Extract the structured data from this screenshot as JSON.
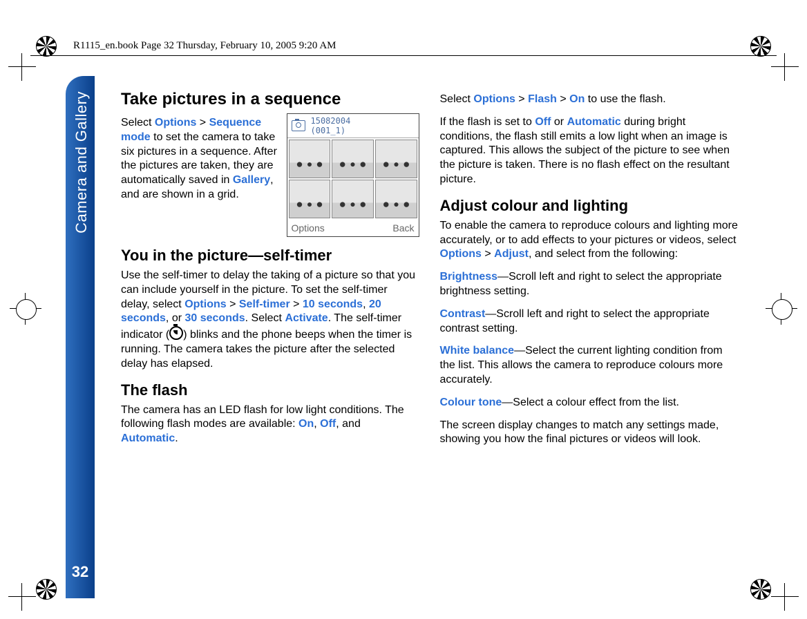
{
  "header": "R1115_en.book  Page 32  Thursday, February 10, 2005  9:20 AM",
  "sideTab": "Camera and Gallery",
  "pageNumber": "32",
  "left": {
    "h_seq": "Take pictures in a sequence",
    "seq_p1a": "Select ",
    "seq_options": "Options",
    "seq_gt1": " > ",
    "seq_mode": "Sequence mode",
    "seq_p1b": " to set the camera to take six pictures in a sequence. After the pictures are taken, they are automatically saved in ",
    "seq_gallery": "Gallery",
    "seq_p1c": ", and are shown in a grid.",
    "shot_date": "15082004",
    "shot_id": "(001_1)",
    "shot_opt": "Options",
    "shot_back": "Back",
    "h_timer": "You in the picture—self-timer",
    "timer_p1a": "Use the self-timer to delay the taking of a picture so that you can include yourself in the picture. To set the self-timer delay, select ",
    "timer_opt": "Options",
    "timer_gt1": " > ",
    "timer_st": "Self-timer",
    "timer_gt2": " > ",
    "timer_10": "10 seconds",
    "timer_comma1": ", ",
    "timer_20": "20 seconds",
    "timer_or": ", or ",
    "timer_30": "30 seconds",
    "timer_dot1": ". Select ",
    "timer_activate": "Activate",
    "timer_p1b": ". The self-timer indicator (",
    "timer_p1c": ") blinks and the phone beeps when the timer is running. The camera takes the picture after the selected delay has elapsed.",
    "h_flash": "The flash",
    "flash_p1a": "The camera has an LED flash for low light conditions. The following flash modes are available: ",
    "flash_on": "On",
    "flash_c1": ", ",
    "flash_off": "Off",
    "flash_c2": ", and ",
    "flash_auto": "Automatic",
    "flash_dot": "."
  },
  "right": {
    "sel_a": "Select ",
    "sel_opt": "Options",
    "sel_gt1": " > ",
    "sel_flash": "Flash",
    "sel_gt2": " > ",
    "sel_on": "On",
    "sel_b": " to use the flash.",
    "p2a": "If the flash is set to ",
    "p2_off": "Off",
    "p2_or": " or ",
    "p2_auto": "Automatic",
    "p2b": " during bright conditions, the flash still emits a low light when an image is captured. This allows the subject of the picture to see when the picture is taken. There is no flash effect on the resultant picture.",
    "h_adjust": "Adjust colour and lighting",
    "adj_p1a": "To enable the camera to reproduce colours and lighting more accurately, or to add effects to your pictures or videos, select ",
    "adj_opt": "Options",
    "adj_gt1": " > ",
    "adj_adjust": "Adjust",
    "adj_p1b": ", and select from the following:",
    "bright_kw": "Brightness",
    "bright_txt": "—Scroll left and right to select the appropriate brightness setting.",
    "contrast_kw": "Contrast",
    "contrast_txt": "—Scroll left and right to select the appropriate contrast setting.",
    "wb_kw": "White balance",
    "wb_txt": "—Select the current lighting condition from the list. This allows the camera to reproduce colours more accurately.",
    "ct_kw": "Colour tone",
    "ct_txt": "—Select a colour effect from the list.",
    "final": "The screen display changes to match any settings made, showing you how the final pictures or videos will look."
  }
}
